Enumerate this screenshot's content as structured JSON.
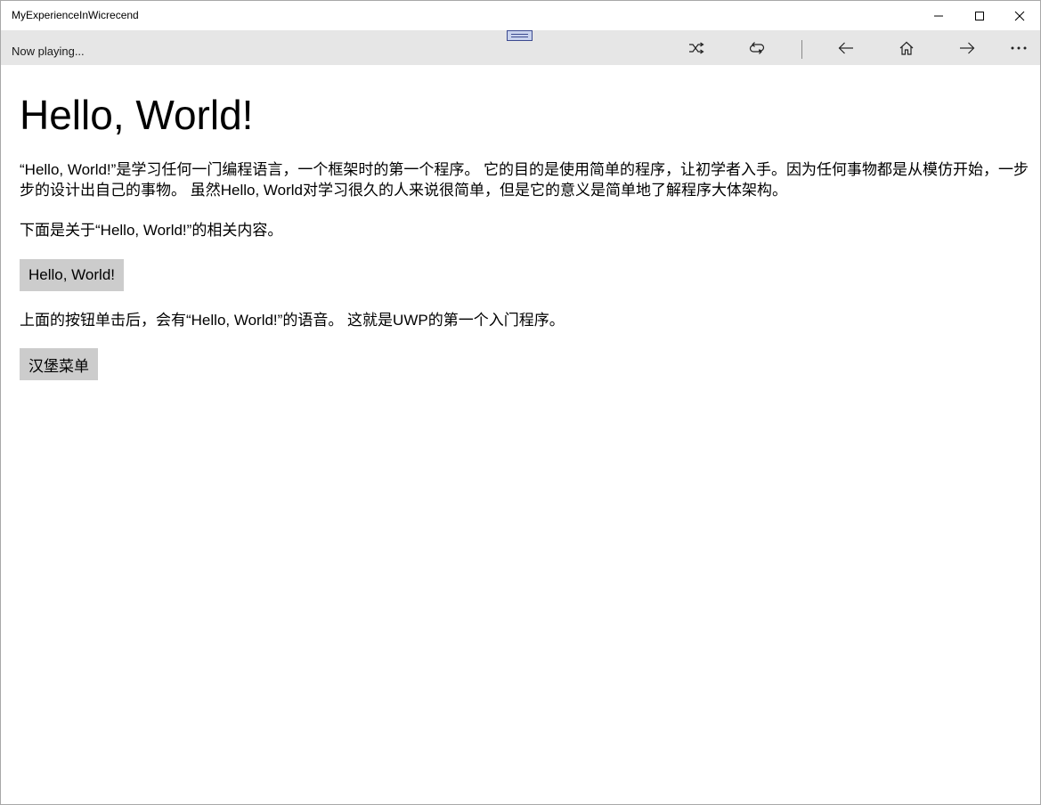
{
  "window": {
    "title": "MyExperienceInWicrecend",
    "controls": {
      "minimize_icon": "minimize-icon",
      "maximize_icon": "maximize-icon",
      "close_icon": "close-icon"
    }
  },
  "commandbar": {
    "status_text": "Now playing...",
    "buttons": [
      {
        "name": "shuffle",
        "icon": "shuffle-icon"
      },
      {
        "name": "repeat",
        "icon": "repeat-icon"
      },
      {
        "name": "back",
        "icon": "arrow-left-icon"
      },
      {
        "name": "home",
        "icon": "home-icon"
      },
      {
        "name": "forward",
        "icon": "arrow-right-icon"
      },
      {
        "name": "more",
        "icon": "more-icon"
      }
    ],
    "background": "#e6e6e6"
  },
  "main": {
    "heading": "Hello, World!",
    "paragraph1": "“Hello, World!”是学习任何一门编程语言，一个框架时的第一个程序。 它的目的是使用简单的程序，让初学者入手。因为任何事物都是从模仿开始，一步步的设计出自己的事物。 虽然Hello, World对学习很久的人来说很简单，但是它的意义是简单地了解程序大体架构。",
    "paragraph2": "下面是关于“Hello, World!”的相关内容。",
    "hello_button": "Hello, World!",
    "paragraph3": "上面的按钮单击后，会有“Hello, World!”的语音。 这就是UWP的第一个入门程序。",
    "menu_button": "汉堡菜单",
    "button_color": "#cccccc"
  }
}
